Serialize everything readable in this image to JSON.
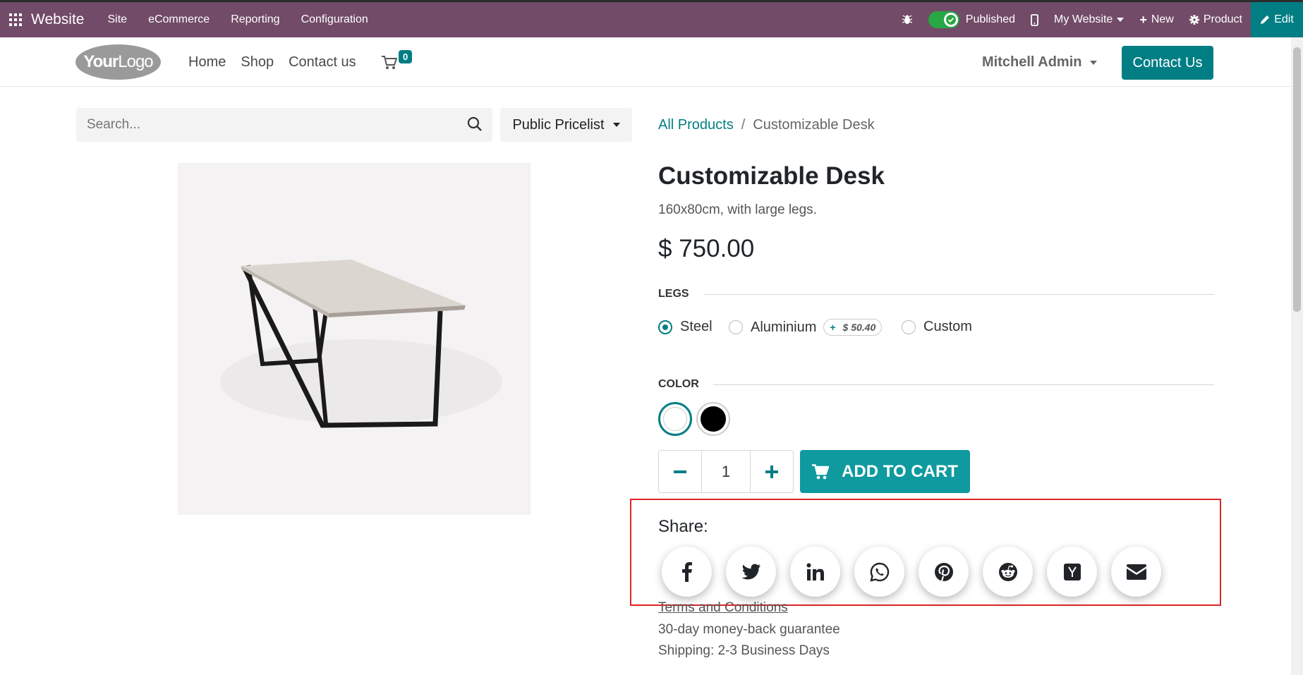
{
  "topbar": {
    "app_name": "Website",
    "menu": [
      "Site",
      "eCommerce",
      "Reporting",
      "Configuration"
    ],
    "published_label": "Published",
    "website_label": "My Website",
    "new_label": "New",
    "product_label": "Product",
    "edit_label": "Edit",
    "bg_color": "#714B67"
  },
  "header": {
    "logo_text_bold": "Your",
    "logo_text_light": "Logo",
    "nav": [
      "Home",
      "Shop",
      "Contact us"
    ],
    "cart_count": "0",
    "user_name": "Mitchell Admin",
    "contact_button": "Contact Us"
  },
  "search": {
    "placeholder": "Search...",
    "pricelist": "Public Pricelist"
  },
  "breadcrumb": {
    "parent": "All Products",
    "separator": "/",
    "current": "Customizable Desk"
  },
  "product": {
    "name": "Customizable Desk",
    "description": "160x80cm, with large legs.",
    "price": "$ 750.00",
    "legs": {
      "title": "LEGS",
      "options": [
        {
          "label": "Steel",
          "selected": true
        },
        {
          "label": "Aluminium",
          "extra_sign": "+",
          "extra_price": "$ 50.40"
        },
        {
          "label": "Custom"
        }
      ]
    },
    "color": {
      "title": "COLOR",
      "options": [
        "#ffffff",
        "#000000"
      ],
      "selected": "#ffffff"
    },
    "quantity": "1",
    "add_to_cart": "ADD TO CART",
    "accent": "#017e84"
  },
  "share": {
    "label": "Share:",
    "icons": [
      "facebook-icon",
      "twitter-icon",
      "linkedin-icon",
      "whatsapp-icon",
      "pinterest-icon",
      "reddit-icon",
      "hackernews-icon",
      "email-icon"
    ]
  },
  "footer_info": {
    "terms": "Terms and Conditions",
    "guarantee": "30-day money-back guarantee",
    "shipping": "Shipping: 2-3 Business Days"
  }
}
